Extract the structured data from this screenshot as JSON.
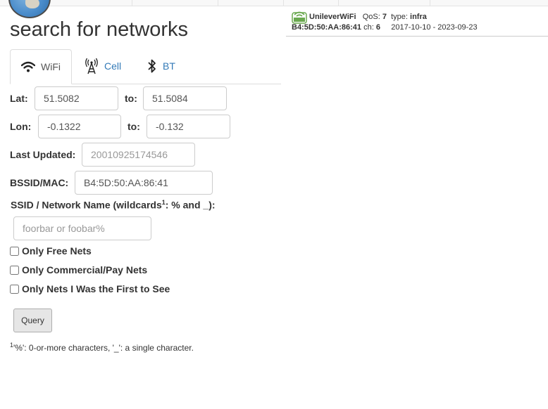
{
  "page": {
    "title": "search for networks"
  },
  "tabs": [
    {
      "label": "WiFi",
      "icon": "wifi-icon",
      "active": true
    },
    {
      "label": "Cell",
      "icon": "cell-tower-icon",
      "active": false
    },
    {
      "label": "BT",
      "icon": "bluetooth-icon",
      "active": false
    }
  ],
  "form": {
    "lat_label": "Lat:",
    "lat_from": "51.5082",
    "lat_to_label": "to:",
    "lat_to": "51.5084",
    "lon_label": "Lon:",
    "lon_from": "-0.1322",
    "lon_to_label": "to:",
    "lon_to": "-0.132",
    "last_updated_label": "Last Updated:",
    "last_updated_placeholder": "20010925174546",
    "bssid_label": "BSSID/MAC:",
    "bssid_value": "B4:5D:50:AA:86:41",
    "ssid_label_pre": "SSID / Network Name (wildcards",
    "ssid_label_sup": "1",
    "ssid_label_post": ": % and _):",
    "ssid_placeholder": "foorbar or foobar%",
    "only_free": "Only Free Nets",
    "only_commercial": "Only Commercial/Pay Nets",
    "only_first": "Only Nets I Was the First to See",
    "query_button": "Query",
    "footnote_sup": "1",
    "footnote": "'%': 0-or-more characters, '_': a single character."
  },
  "result": {
    "icon": "wifi-network-icon",
    "ssid": "UnileverWiFi",
    "qos_label": "QoS:",
    "qos": "7",
    "type_label": "type:",
    "type": "infra",
    "bssid": "B4:5D:50:AA:86:41",
    "ch_label": "ch:",
    "ch": "6",
    "dates": "2017-10-10 - 2023-09-23"
  },
  "colors": {
    "link": "#337ab7",
    "result_icon": "#6aa84f"
  }
}
